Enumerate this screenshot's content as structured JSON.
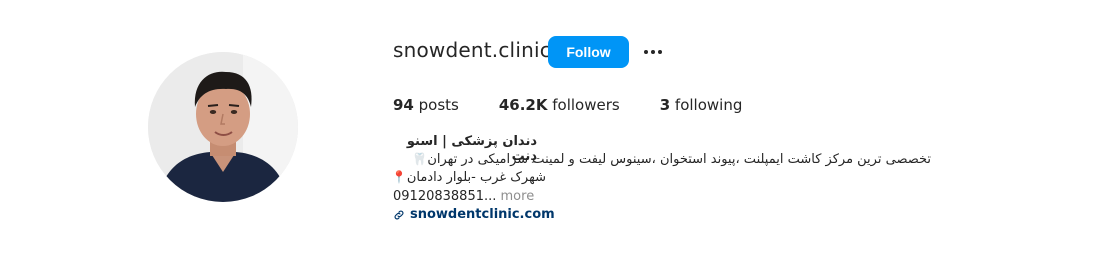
{
  "profile": {
    "username": "snowdent.clinic",
    "follow_label": "Follow",
    "more_label": "•••",
    "stats": {
      "posts_count": "94",
      "posts_label": " posts",
      "followers_count": "46.2K",
      "followers_label": " followers",
      "following_count": "3",
      "following_label": " following"
    },
    "bio": {
      "name": "دندان پزشکی | اسنو دِنت",
      "line1": "تخصصی ترین مرکز کاشت ایمپلنت ،پیوند استخوان ،سینوس لیفت و لمینت سرامیکی در تهران",
      "line1_emoji": "tooth-icon",
      "line2": "شهرک غرب -بلوار دادمان",
      "line2_emoji": "pin-icon",
      "line3": "09120838851...",
      "more_label": " more",
      "link": "snowdentclinic.com"
    }
  },
  "colors": {
    "follow_button": "#0095f6",
    "link": "#00376b",
    "muted": "#8e8e8e"
  }
}
